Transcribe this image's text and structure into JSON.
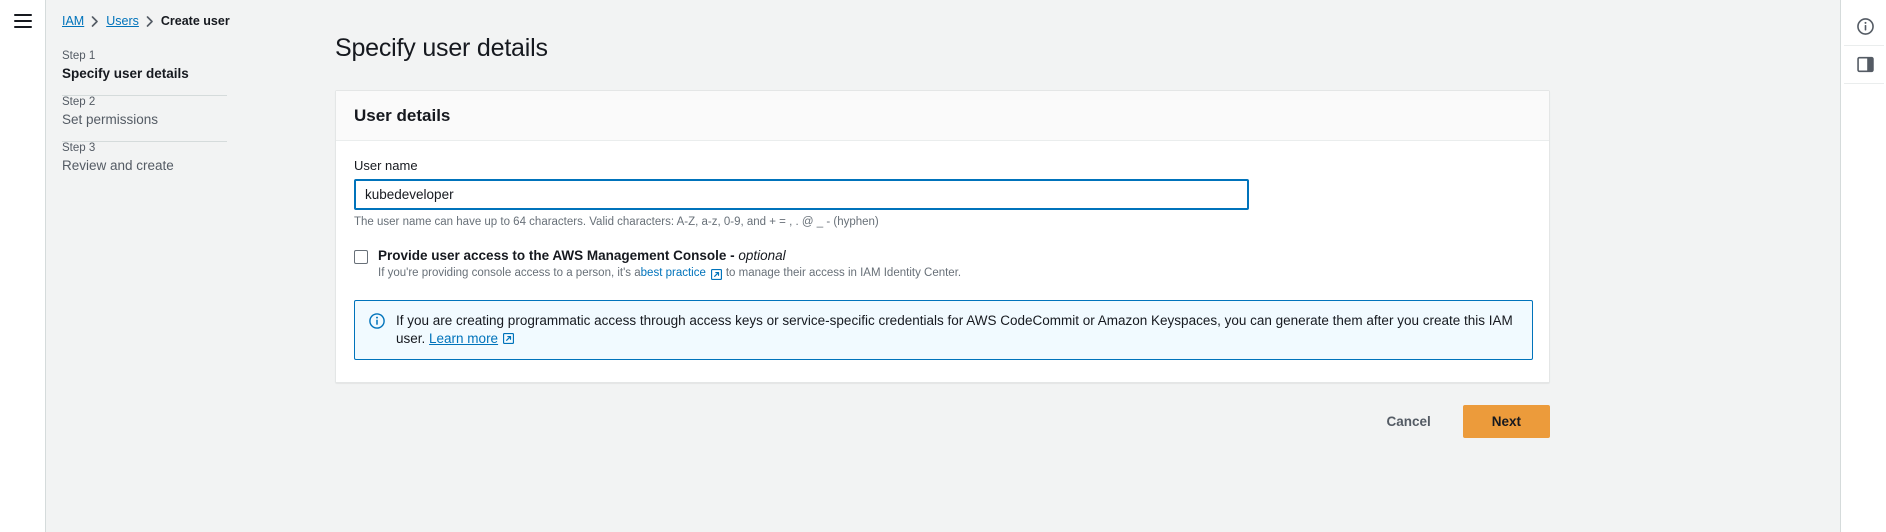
{
  "left_rail": {
    "menu_icon": "hamburger-menu-icon"
  },
  "breadcrumb": {
    "items": [
      {
        "label": "IAM",
        "type": "link"
      },
      {
        "label": "Users",
        "type": "link"
      },
      {
        "label": "Create user",
        "type": "current"
      }
    ]
  },
  "sidebar": {
    "steps": [
      {
        "num": "Step 1",
        "title": "Specify user details",
        "active": true
      },
      {
        "num": "Step 2",
        "title": "Set permissions",
        "active": false
      },
      {
        "num": "Step 3",
        "title": "Review and create",
        "active": false
      }
    ]
  },
  "main": {
    "page_title": "Specify user details",
    "card": {
      "title": "User details",
      "username_label": "User name",
      "username_value": "kubedeveloper",
      "username_placeholder": "",
      "username_helper": "The user name can have up to 64 characters. Valid characters: A-Z, a-z, 0-9, and + = , . @ _ - (hyphen)",
      "console_access": {
        "checked": false,
        "label": "Provide user access to the AWS Management Console - ",
        "label_optional": "optional",
        "sub_prefix": "If you're providing console access to a person, it's a ",
        "sub_link": "best practice",
        "sub_suffix": "to manage their access in IAM Identity Center."
      },
      "alert": {
        "icon": "info-circle-icon",
        "text": "If you are creating programmatic access through access keys or service-specific credentials for AWS CodeCommit or Amazon Keyspaces, you can generate them after you create this IAM user. ",
        "link": "Learn more"
      }
    },
    "footer": {
      "cancel_label": "Cancel",
      "next_label": "Next"
    }
  },
  "right_rail": {
    "buttons": [
      {
        "icon": "info-circle-icon"
      },
      {
        "icon": "side-panel-icon"
      }
    ]
  },
  "colors": {
    "accent_link": "#0073bb",
    "primary_button": "#ec9b3b",
    "page_background": "#f2f3f3",
    "alert_background": "#f1faff"
  }
}
